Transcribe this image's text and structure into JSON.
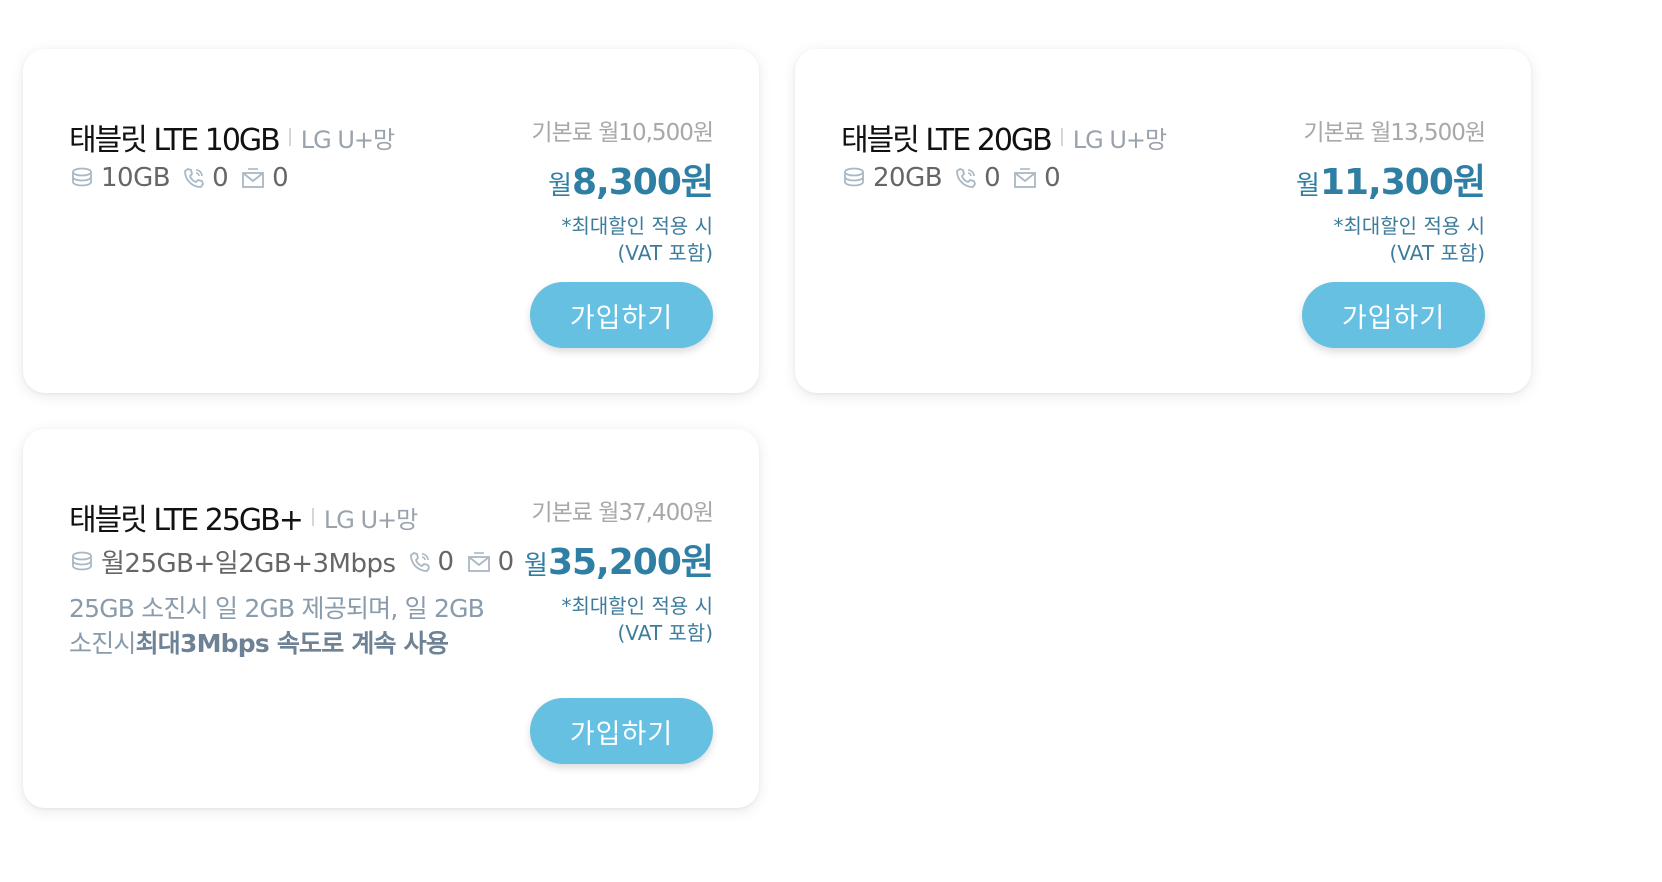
{
  "plans": [
    {
      "name": "태블릿 LTE 10GB",
      "carrier": "LG U+망",
      "data": "10GB",
      "calls": "0",
      "sms": "0",
      "description_plain": "",
      "description_bold": "",
      "base_price": "기본료 월10,500원",
      "sale_prefix": "월",
      "sale_amount": "8,300원",
      "note_line1": "*최대할인 적용 시",
      "note_line2": "(VAT 포함)",
      "button_label": "가입하기"
    },
    {
      "name": "태블릿 LTE 20GB",
      "carrier": "LG U+망",
      "data": "20GB",
      "calls": "0",
      "sms": "0",
      "description_plain": "",
      "description_bold": "",
      "base_price": "기본료 월13,500원",
      "sale_prefix": "월",
      "sale_amount": "11,300원",
      "note_line1": "*최대할인 적용 시",
      "note_line2": "(VAT 포함)",
      "button_label": "가입하기"
    },
    {
      "name": "태블릿 LTE 25GB+",
      "carrier": "LG U+망",
      "data": "월25GB+일2GB+3Mbps",
      "calls": "0",
      "sms": "0",
      "description_plain": "25GB 소진시 일 2GB 제공되며, 일 2GB 소진시",
      "description_bold": "최대3Mbps 속도로 계속 사용",
      "base_price": "기본료 월37,400원",
      "sale_prefix": "월",
      "sale_amount": "35,200원",
      "note_line1": "*최대할인 적용 시",
      "note_line2": "(VAT 포함)",
      "button_label": "가입하기"
    }
  ],
  "colors": {
    "accent": "#66c0e2",
    "price": "#2f7fa5",
    "note": "#3d7c9c",
    "muted": "#a8a8a8",
    "icon": "#a9b8c5"
  },
  "icons": {
    "data": "data-stack-icon",
    "calls": "phone-icon",
    "sms": "envelope-icon"
  }
}
